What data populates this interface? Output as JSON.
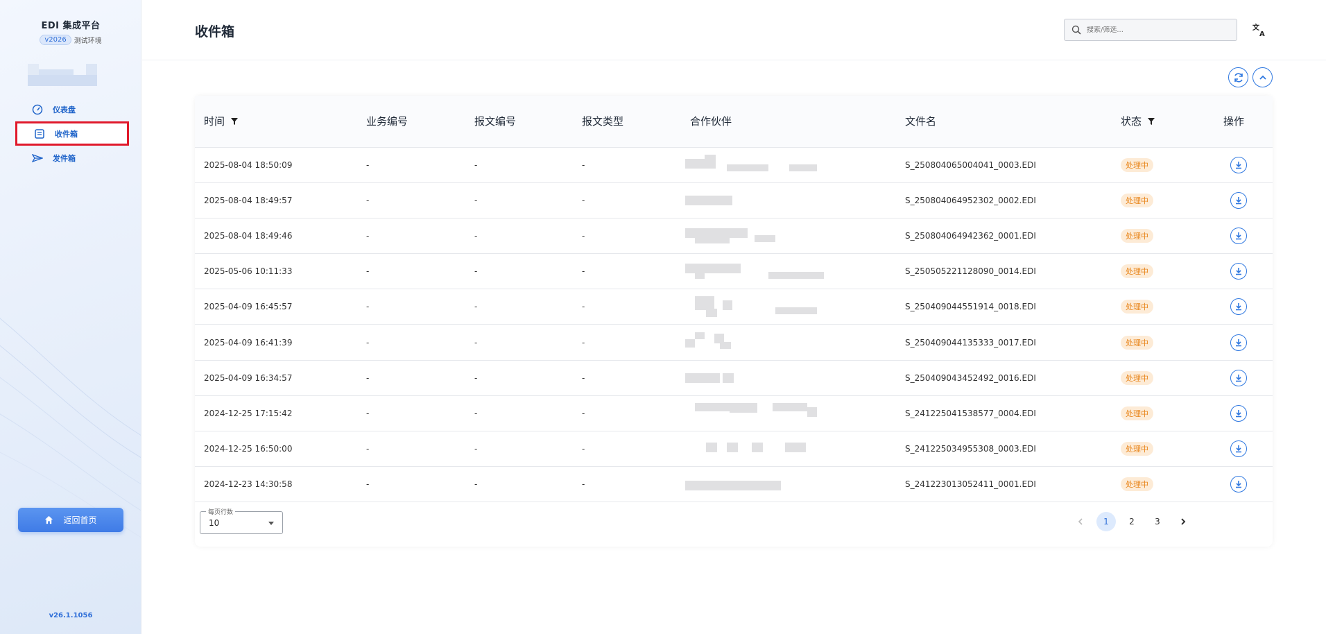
{
  "brand": {
    "title": "EDI 集成平台",
    "version_badge": "v2026",
    "env_label": "测试环境"
  },
  "nav": [
    {
      "label": "仪表盘",
      "icon": "gauge-icon"
    },
    {
      "label": "收件箱",
      "icon": "inbox-icon",
      "active": true
    },
    {
      "label": "发件箱",
      "icon": "send-icon"
    }
  ],
  "home_button": {
    "label": "返回首页",
    "icon": "home-icon"
  },
  "footer_version": "v26.1.1056",
  "header": {
    "title": "收件箱",
    "search_placeholder": "搜索/筛选...",
    "lang_icon": "translate-icon"
  },
  "toolbar": {
    "refresh_icon": "refresh-icon",
    "collapse_icon": "chevron-up-icon"
  },
  "table": {
    "columns": [
      "时间",
      "业务编号",
      "报文编号",
      "报文类型",
      "合作伙伴",
      "文件名",
      "状态",
      "操作"
    ],
    "rows": [
      {
        "time": "2025-08-04 18:50:09",
        "biz": "-",
        "msg": "-",
        "type": "-",
        "file": "S_250804065004041_0003.EDI",
        "status": "处理中"
      },
      {
        "time": "2025-08-04 18:49:57",
        "biz": "-",
        "msg": "-",
        "type": "-",
        "file": "S_250804064952302_0002.EDI",
        "status": "处理中"
      },
      {
        "time": "2025-08-04 18:49:46",
        "biz": "-",
        "msg": "-",
        "type": "-",
        "file": "S_250804064942362_0001.EDI",
        "status": "处理中"
      },
      {
        "time": "2025-05-06 10:11:33",
        "biz": "-",
        "msg": "-",
        "type": "-",
        "file": "S_250505221128090_0014.EDI",
        "status": "处理中"
      },
      {
        "time": "2025-04-09 16:45:57",
        "biz": "-",
        "msg": "-",
        "type": "-",
        "file": "S_250409044551914_0018.EDI",
        "status": "处理中"
      },
      {
        "time": "2025-04-09 16:41:39",
        "biz": "-",
        "msg": "-",
        "type": "-",
        "file": "S_250409044135333_0017.EDI",
        "status": "处理中"
      },
      {
        "time": "2025-04-09 16:34:57",
        "biz": "-",
        "msg": "-",
        "type": "-",
        "file": "S_250409043452492_0016.EDI",
        "status": "处理中"
      },
      {
        "time": "2024-12-25 17:15:42",
        "biz": "-",
        "msg": "-",
        "type": "-",
        "file": "S_241225041538577_0004.EDI",
        "status": "处理中"
      },
      {
        "time": "2024-12-25 16:50:00",
        "biz": "-",
        "msg": "-",
        "type": "-",
        "file": "S_241225034955308_0003.EDI",
        "status": "处理中"
      },
      {
        "time": "2024-12-23 14:30:58",
        "biz": "-",
        "msg": "-",
        "type": "-",
        "file": "S_241223013052411_0001.EDI",
        "status": "处理中"
      }
    ]
  },
  "pagination": {
    "rows_per_page_label": "每页行数",
    "rows_per_page": "10",
    "pages": [
      "1",
      "2",
      "3"
    ],
    "current_page": "1"
  },
  "colors": {
    "accent": "#2f78e0",
    "status_bg": "#fdebd6",
    "status_text": "#e8861c",
    "highlight_border": "#e0192b"
  }
}
